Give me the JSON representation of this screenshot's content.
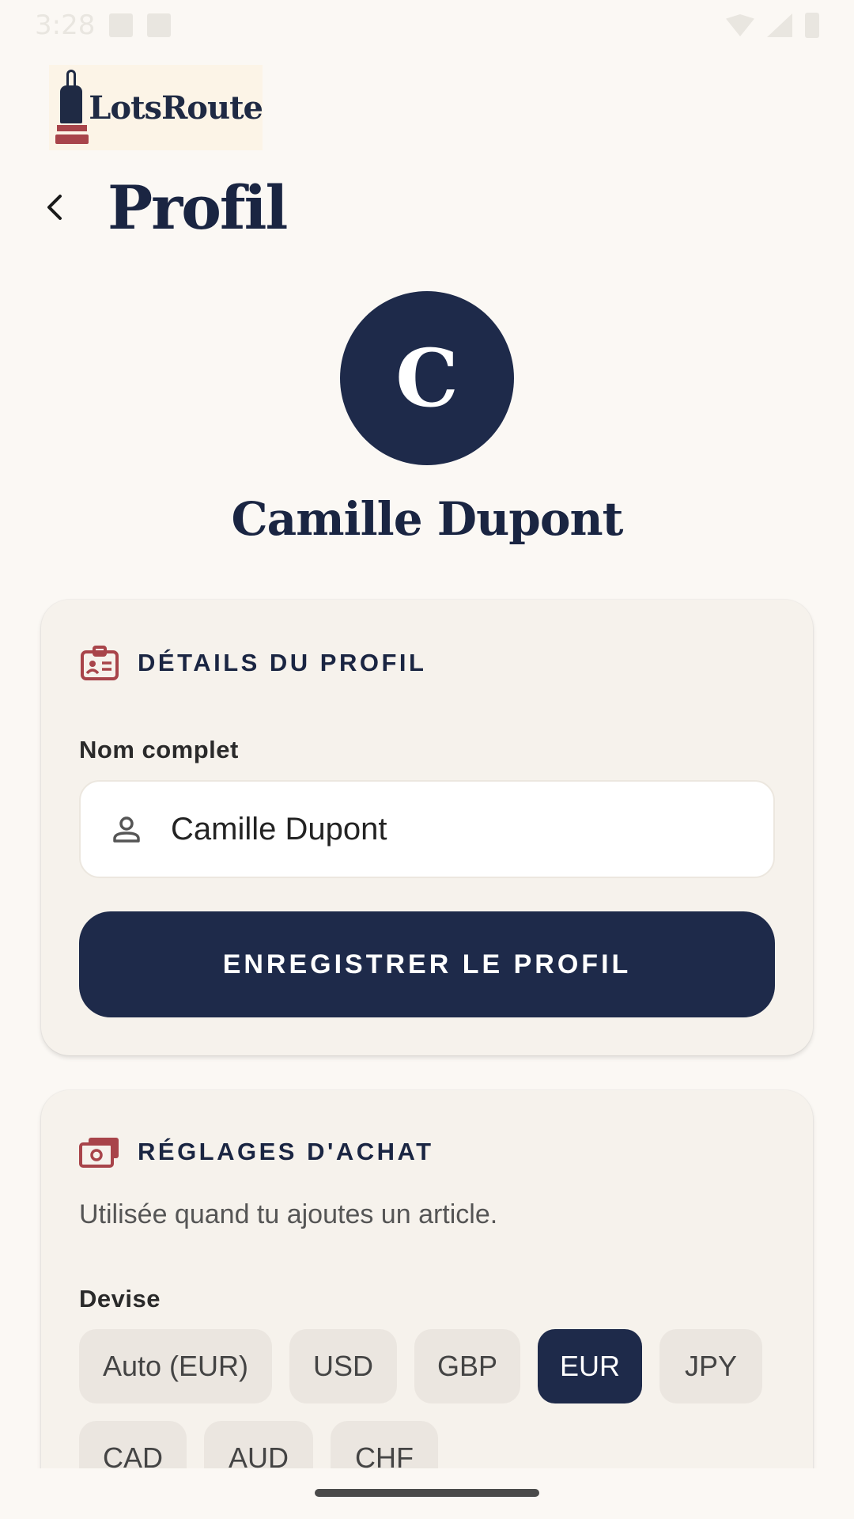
{
  "status_bar": {
    "time": "3:28"
  },
  "logo": {
    "text": "LotsRoute"
  },
  "header": {
    "title": "Profil"
  },
  "profile": {
    "initial": "C",
    "name": "Camille Dupont"
  },
  "details_card": {
    "title": "DÉTAILS DU PROFIL",
    "name_label": "Nom complet",
    "name_value": "Camille Dupont",
    "save_label": "ENREGISTRER LE PROFIL"
  },
  "purchase_card": {
    "title": "RÉGLAGES D'ACHAT",
    "helper": "Utilisée quand tu ajoutes un article.",
    "currency_label": "Devise",
    "currencies": [
      {
        "label": "Auto (EUR)",
        "selected": false
      },
      {
        "label": "USD",
        "selected": false
      },
      {
        "label": "GBP",
        "selected": false
      },
      {
        "label": "EUR",
        "selected": true
      },
      {
        "label": "JPY",
        "selected": false
      },
      {
        "label": "CAD",
        "selected": false
      },
      {
        "label": "AUD",
        "selected": false
      },
      {
        "label": "CHF",
        "selected": false
      }
    ]
  },
  "colors": {
    "navy": "#1e2a4a",
    "accent_red": "#a8444a",
    "background": "#fbf8f4"
  }
}
